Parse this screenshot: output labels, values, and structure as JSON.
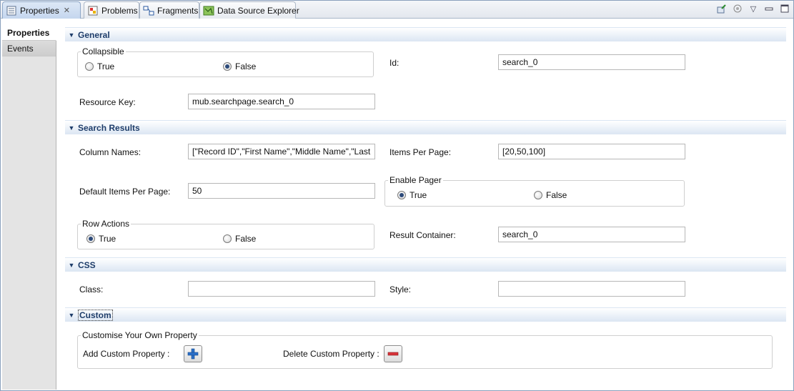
{
  "tabs": [
    {
      "label": "Properties",
      "icon": "properties-icon",
      "active": true
    },
    {
      "label": "Problems",
      "icon": "problems-icon"
    },
    {
      "label": "Fragments",
      "icon": "fragments-icon"
    },
    {
      "label": "Data Source Explorer",
      "icon": "data-source-icon"
    }
  ],
  "toolbar": {
    "icons": [
      "pin-icon",
      "filter-icon",
      "view-menu-icon",
      "minimize-icon",
      "maximize-icon"
    ]
  },
  "leftnav": {
    "items": [
      "Properties",
      "Events"
    ]
  },
  "general": {
    "title": "General",
    "collapsible": {
      "title": "Collapsible",
      "options": [
        "True",
        "False"
      ],
      "selected": "False"
    },
    "id_label": "Id:",
    "id_value": "search_0",
    "resource_key_label": "Resource Key:",
    "resource_key_value": "mub.searchpage.search_0"
  },
  "search_results": {
    "title": "Search Results",
    "column_names_label": "Column Names:",
    "column_names_value": "[\"Record ID\",\"First Name\",\"Middle Name\",\"Last",
    "items_per_page_label": "Items Per Page:",
    "items_per_page_value": "[20,50,100]",
    "default_items_label": "Default Items Per Page:",
    "default_items_value": "50",
    "enable_pager": {
      "title": "Enable Pager",
      "options": [
        "True",
        "False"
      ],
      "selected": "True"
    },
    "row_actions": {
      "title": "Row Actions",
      "options": [
        "True",
        "False"
      ],
      "selected": "True"
    },
    "result_container_label": "Result Container:",
    "result_container_value": "search_0"
  },
  "css": {
    "title": "CSS",
    "class_label": "Class:",
    "class_value": "",
    "style_label": "Style:",
    "style_value": ""
  },
  "custom": {
    "title": "Custom",
    "group_title": "Customise Your Own Property",
    "add_label": "Add Custom Property :",
    "delete_label": "Delete Custom Property :"
  }
}
